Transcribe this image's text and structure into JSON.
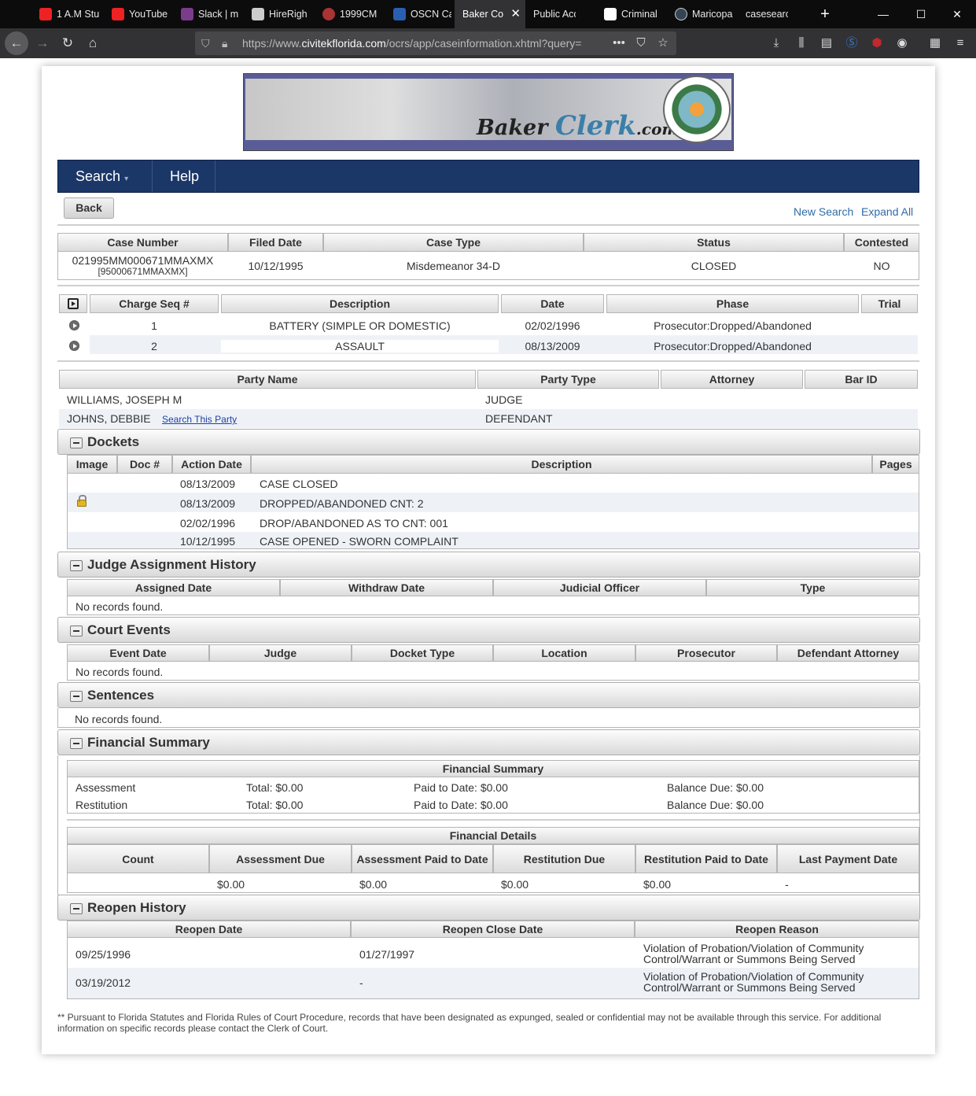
{
  "browser": {
    "tabs": [
      {
        "label": "1 A.M Stu",
        "color": "#e22"
      },
      {
        "label": "YouTube",
        "color": "#e22"
      },
      {
        "label": "Slack | m",
        "color": "#7b3c8c"
      },
      {
        "label": "HireRigh",
        "color": "#222"
      },
      {
        "label": "1999CM",
        "color": "#a33"
      },
      {
        "label": "OSCN Ca",
        "color": "#2a5fb0"
      },
      {
        "label": "Baker Co",
        "color": "#777"
      },
      {
        "label": "Public Access",
        "color": "#444"
      },
      {
        "label": "Criminal",
        "color": "#fff"
      },
      {
        "label": "Maricopa",
        "color": "#345"
      },
      {
        "label": "casesearch.e",
        "color": "#555"
      }
    ],
    "url_prefix": "https://www.",
    "url_domain": "civitekflorida.com",
    "url_path": "/ocrs/app/caseinformation.xhtml?query="
  },
  "nav": {
    "search": "Search",
    "help": "Help"
  },
  "actions": {
    "back": "Back",
    "new_search": "New Search",
    "expand_all": "Expand All"
  },
  "case": {
    "headers": [
      "Case Number",
      "Filed Date",
      "Case Type",
      "Status",
      "Contested"
    ],
    "number": "021995MM000671MMAXMX",
    "number_alt": "[95000671MMAXMX]",
    "filed": "10/12/1995",
    "type": "Misdemeanor 34-D",
    "status": "CLOSED",
    "contested": "NO"
  },
  "charges": {
    "headers": [
      "Charge Seq #",
      "Description",
      "Date",
      "Phase",
      "Trial"
    ],
    "rows": [
      {
        "seq": "1",
        "desc": "BATTERY (SIMPLE OR DOMESTIC)",
        "date": "02/02/1996",
        "phase": "Prosecutor:Dropped/Abandoned",
        "trial": ""
      },
      {
        "seq": "2",
        "desc": "ASSAULT",
        "date": "08/13/2009",
        "phase": "Prosecutor:Dropped/Abandoned",
        "trial": ""
      }
    ]
  },
  "parties": {
    "headers": [
      "Party Name",
      "Party Type",
      "Attorney",
      "Bar ID"
    ],
    "rows": [
      {
        "name": "WILLIAMS, JOSEPH M",
        "type": "JUDGE",
        "link": ""
      },
      {
        "name": "JOHNS, DEBBIE",
        "type": "DEFENDANT",
        "link": "Search This Party"
      }
    ]
  },
  "dockets": {
    "title": "Dockets",
    "headers": [
      "Image",
      "Doc #",
      "Action Date",
      "Description",
      "Pages"
    ],
    "rows": [
      {
        "date": "08/13/2009",
        "desc": "CASE CLOSED"
      },
      {
        "date": "08/13/2009",
        "desc": "DROPPED/ABANDONED CNT: 2"
      },
      {
        "date": "02/02/1996",
        "desc": "DROP/ABANDONED AS TO CNT: 001"
      },
      {
        "date": "10/12/1995",
        "desc": "CASE OPENED - SWORN COMPLAINT"
      }
    ]
  },
  "judge": {
    "title": "Judge Assignment History",
    "headers": [
      "Assigned Date",
      "Withdraw Date",
      "Judicial Officer",
      "Type"
    ],
    "empty": "No records found."
  },
  "events": {
    "title": "Court Events",
    "headers": [
      "Event Date",
      "Judge",
      "Docket Type",
      "Location",
      "Prosecutor",
      "Defendant Attorney"
    ],
    "empty": "No records found."
  },
  "sentences": {
    "title": "Sentences",
    "empty": "No records found."
  },
  "financial": {
    "title": "Financial Summary",
    "summary_header": "Financial Summary",
    "rows": [
      {
        "label": "Assessment",
        "total": "Total: $0.00",
        "paid": "Paid to Date: $0.00",
        "due": "Balance Due: $0.00"
      },
      {
        "label": "Restitution",
        "total": "Total: $0.00",
        "paid": "Paid to Date: $0.00",
        "due": "Balance Due: $0.00"
      }
    ],
    "details_header": "Financial Details",
    "details_headers": [
      "Count",
      "Assessment Due",
      "Assessment Paid to Date",
      "Restitution Due",
      "Restitution Paid to Date",
      "Last Payment Date"
    ],
    "details_row": [
      "",
      "$0.00",
      "$0.00",
      "$0.00",
      "$0.00",
      "-"
    ]
  },
  "reopen": {
    "title": "Reopen History",
    "headers": [
      "Reopen Date",
      "Reopen Close Date",
      "Reopen Reason"
    ],
    "rows": [
      {
        "date": "09/25/1996",
        "close": "01/27/1997",
        "reason1": "Violation of Probation/Violation of Community",
        "reason2": "Control/Warrant or Summons Being Served"
      },
      {
        "date": "03/19/2012",
        "close": "-",
        "reason1": "Violation of Probation/Violation of Community",
        "reason2": "Control/Warrant or Summons Being Served"
      }
    ]
  },
  "footnote": "** Pursuant to Florida Statutes and Florida Rules of Court Procedure, records that have been designated as expunged, sealed or confidential may not be available through this service. For additional information on specific records please contact the Clerk of Court."
}
